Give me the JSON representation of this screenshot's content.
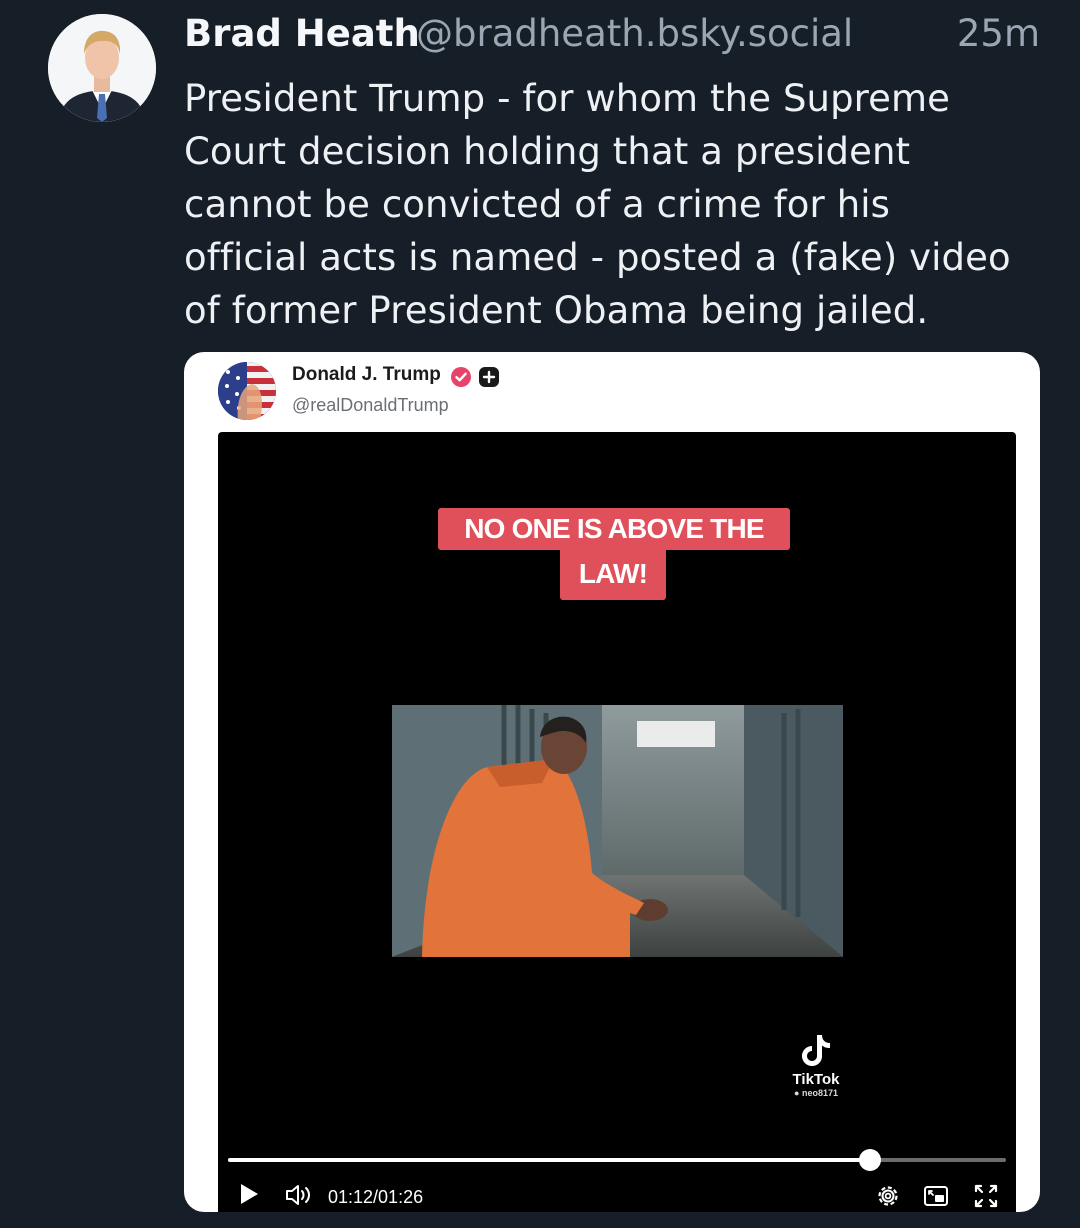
{
  "post": {
    "author_name": "Brad Heath",
    "author_handle": "@bradheath.bsky.social",
    "time": "25m",
    "text_lines": [
      "President Trump - for whom the Supreme",
      "Court decision holding that a president",
      "cannot be convicted of a crime for his",
      "official acts is named - posted a (fake) video",
      "of former President Obama being jailed."
    ]
  },
  "embed": {
    "author_name": "Donald J. Trump",
    "author_handle": "@realDonaldTrump",
    "video": {
      "banner_line1": "NO ONE IS ABOVE THE",
      "banner_line2": "LAW!",
      "watermark_name": "TikTok",
      "watermark_user": "neo8171",
      "elapsed": "01:12",
      "duration": "01:26",
      "time_display": "01:12/01:26",
      "progress": 0.825
    }
  },
  "colors": {
    "background": "#161e27",
    "banner": "#e0505a",
    "verified": "#e8436a"
  },
  "icons": [
    "play-icon",
    "volume-icon",
    "settings-icon",
    "picture-in-picture-icon",
    "fullscreen-icon",
    "tiktok-logo-icon",
    "verified-icon",
    "plus-badge-icon"
  ]
}
